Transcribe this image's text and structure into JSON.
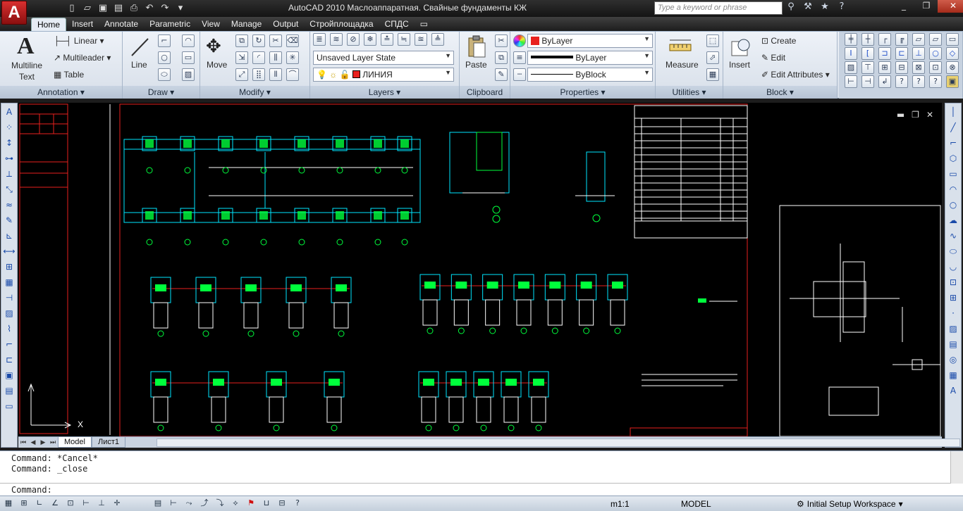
{
  "app": {
    "logo": "A",
    "title": "AutoCAD 2010    Маслоаппаратная. Свайные фундаменты КЖ"
  },
  "search": {
    "placeholder": "Type a keyword or phrase"
  },
  "tabs": [
    "Home",
    "Insert",
    "Annotate",
    "Parametric",
    "View",
    "Manage",
    "Output",
    "Стройплощадка",
    "СПДС"
  ],
  "ribbon": {
    "annotation": {
      "title": "Annotation",
      "multiline_text": "Multiline Text",
      "linear": "Linear",
      "multileader": "Multileader",
      "table": "Table"
    },
    "draw": {
      "title": "Draw",
      "line": "Line"
    },
    "modify": {
      "title": "Modify",
      "move": "Move"
    },
    "layers": {
      "title": "Layers",
      "layer_state": "Unsaved Layer State",
      "current_layer": "ЛИНИЯ"
    },
    "clipboard": {
      "title": "Clipboard",
      "paste": "Paste"
    },
    "properties": {
      "title": "Properties",
      "color": "ByLayer",
      "linetype": "ByLayer",
      "lineweight": "ByBlock"
    },
    "utilities": {
      "title": "Utilities",
      "measure": "Measure"
    },
    "block": {
      "title": "Block",
      "insert": "Insert",
      "create": "Create",
      "edit": "Edit",
      "edit_attributes": "Edit Attributes"
    }
  },
  "viewport": {
    "ucs_x": "X",
    "ucs_y": "Y"
  },
  "layout_tabs": [
    "Model",
    "Лист1"
  ],
  "command": {
    "history": [
      "Command: *Cancel*",
      "Command: _close"
    ],
    "prompt": "Command:"
  },
  "status": {
    "scale": "m1:1",
    "space": "MODEL",
    "workspace": "Initial Setup Workspace"
  },
  "colors": {
    "accent_red": "#e8211e",
    "cad_green": "#00ff3c",
    "cad_cyan": "#00e6ff"
  }
}
